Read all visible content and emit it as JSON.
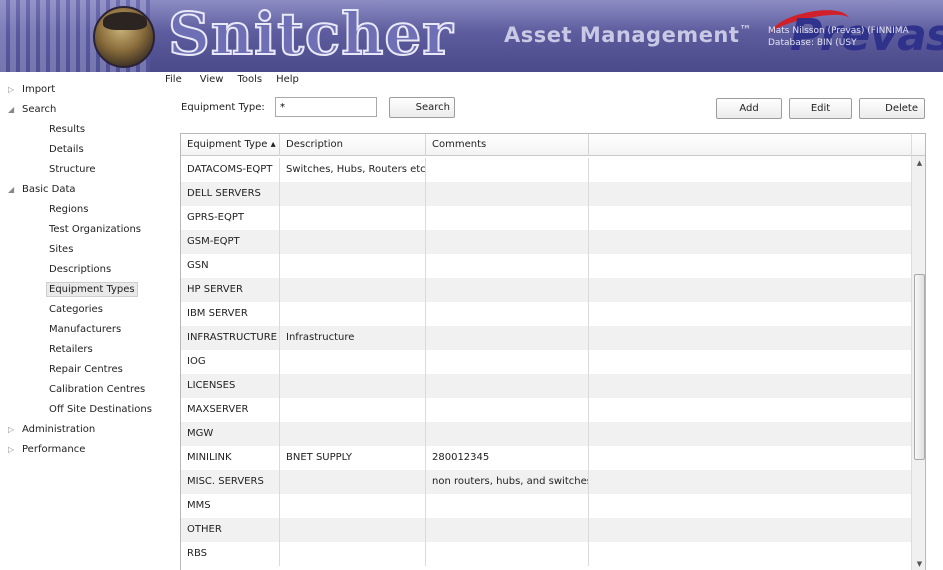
{
  "header": {
    "brand": "Snitcher",
    "subtitle": "Asset Management",
    "trademark": "™",
    "user_line": "Mats Nilsson (Prevas) (FINNIMA",
    "database_line": "Database: BIN (USY",
    "logo_text": "Prevas",
    "logo_icon": "spy-mascot-icon"
  },
  "menu": {
    "items": [
      "File",
      "View",
      "Tools",
      "Help"
    ]
  },
  "sidebar": {
    "nodes": [
      {
        "label": "Import",
        "level": 0,
        "expander": "collapsed"
      },
      {
        "label": "Search",
        "level": 0,
        "expander": "expanded"
      },
      {
        "label": "Results",
        "level": 1
      },
      {
        "label": "Details",
        "level": 1
      },
      {
        "label": "Structure",
        "level": 1
      },
      {
        "label": "Basic Data",
        "level": 0,
        "expander": "expanded"
      },
      {
        "label": "Regions",
        "level": 1
      },
      {
        "label": "Test Organizations",
        "level": 1
      },
      {
        "label": "Sites",
        "level": 1
      },
      {
        "label": "Descriptions",
        "level": 1
      },
      {
        "label": "Equipment Types",
        "level": 1,
        "selected": true
      },
      {
        "label": "Categories",
        "level": 1
      },
      {
        "label": "Manufacturers",
        "level": 1
      },
      {
        "label": "Retailers",
        "level": 1
      },
      {
        "label": "Repair Centres",
        "level": 1
      },
      {
        "label": "Calibration Centres",
        "level": 1
      },
      {
        "label": "Off Site Destinations",
        "level": 1
      },
      {
        "label": "Administration",
        "level": 0,
        "expander": "collapsed"
      },
      {
        "label": "Performance",
        "level": 0,
        "expander": "collapsed"
      }
    ]
  },
  "toolbar": {
    "equipment_type_label": "Equipment Type:",
    "equipment_type_value": "*",
    "search_label": "Search",
    "add_label": "Add",
    "edit_label": "Edit",
    "delete_label": "Delete"
  },
  "grid": {
    "columns": [
      "Equipment Type ▴",
      "Description",
      "Comments",
      ""
    ],
    "sort_column": "Equipment Type",
    "rows": [
      [
        "DATACOMS-EQPT",
        "Switches, Hubs, Routers etc.",
        ""
      ],
      [
        "DELL SERVERS",
        "",
        ""
      ],
      [
        "GPRS-EQPT",
        "",
        ""
      ],
      [
        "GSM-EQPT",
        "",
        ""
      ],
      [
        "GSN",
        "",
        ""
      ],
      [
        "HP SERVER",
        "",
        ""
      ],
      [
        "IBM SERVER",
        "",
        ""
      ],
      [
        "INFRASTRUCTURE",
        "Infrastructure",
        ""
      ],
      [
        "IOG",
        "",
        ""
      ],
      [
        "LICENSES",
        "",
        ""
      ],
      [
        "MAXSERVER",
        "",
        ""
      ],
      [
        "MGW",
        "",
        ""
      ],
      [
        "MINILINK",
        "BNET SUPPLY",
        "280012345"
      ],
      [
        "MISC. SERVERS",
        "",
        "non routers, hubs, and switches"
      ],
      [
        "MMS",
        "",
        ""
      ],
      [
        "OTHER",
        "",
        ""
      ],
      [
        "RBS",
        "",
        ""
      ]
    ]
  },
  "colors": {
    "banner": "#5c5c9e",
    "selection": "#e9e9e9",
    "row_alt": "#f1f1f1",
    "logo_red": "#d0202a",
    "logo_blue": "#2c2f8a"
  }
}
